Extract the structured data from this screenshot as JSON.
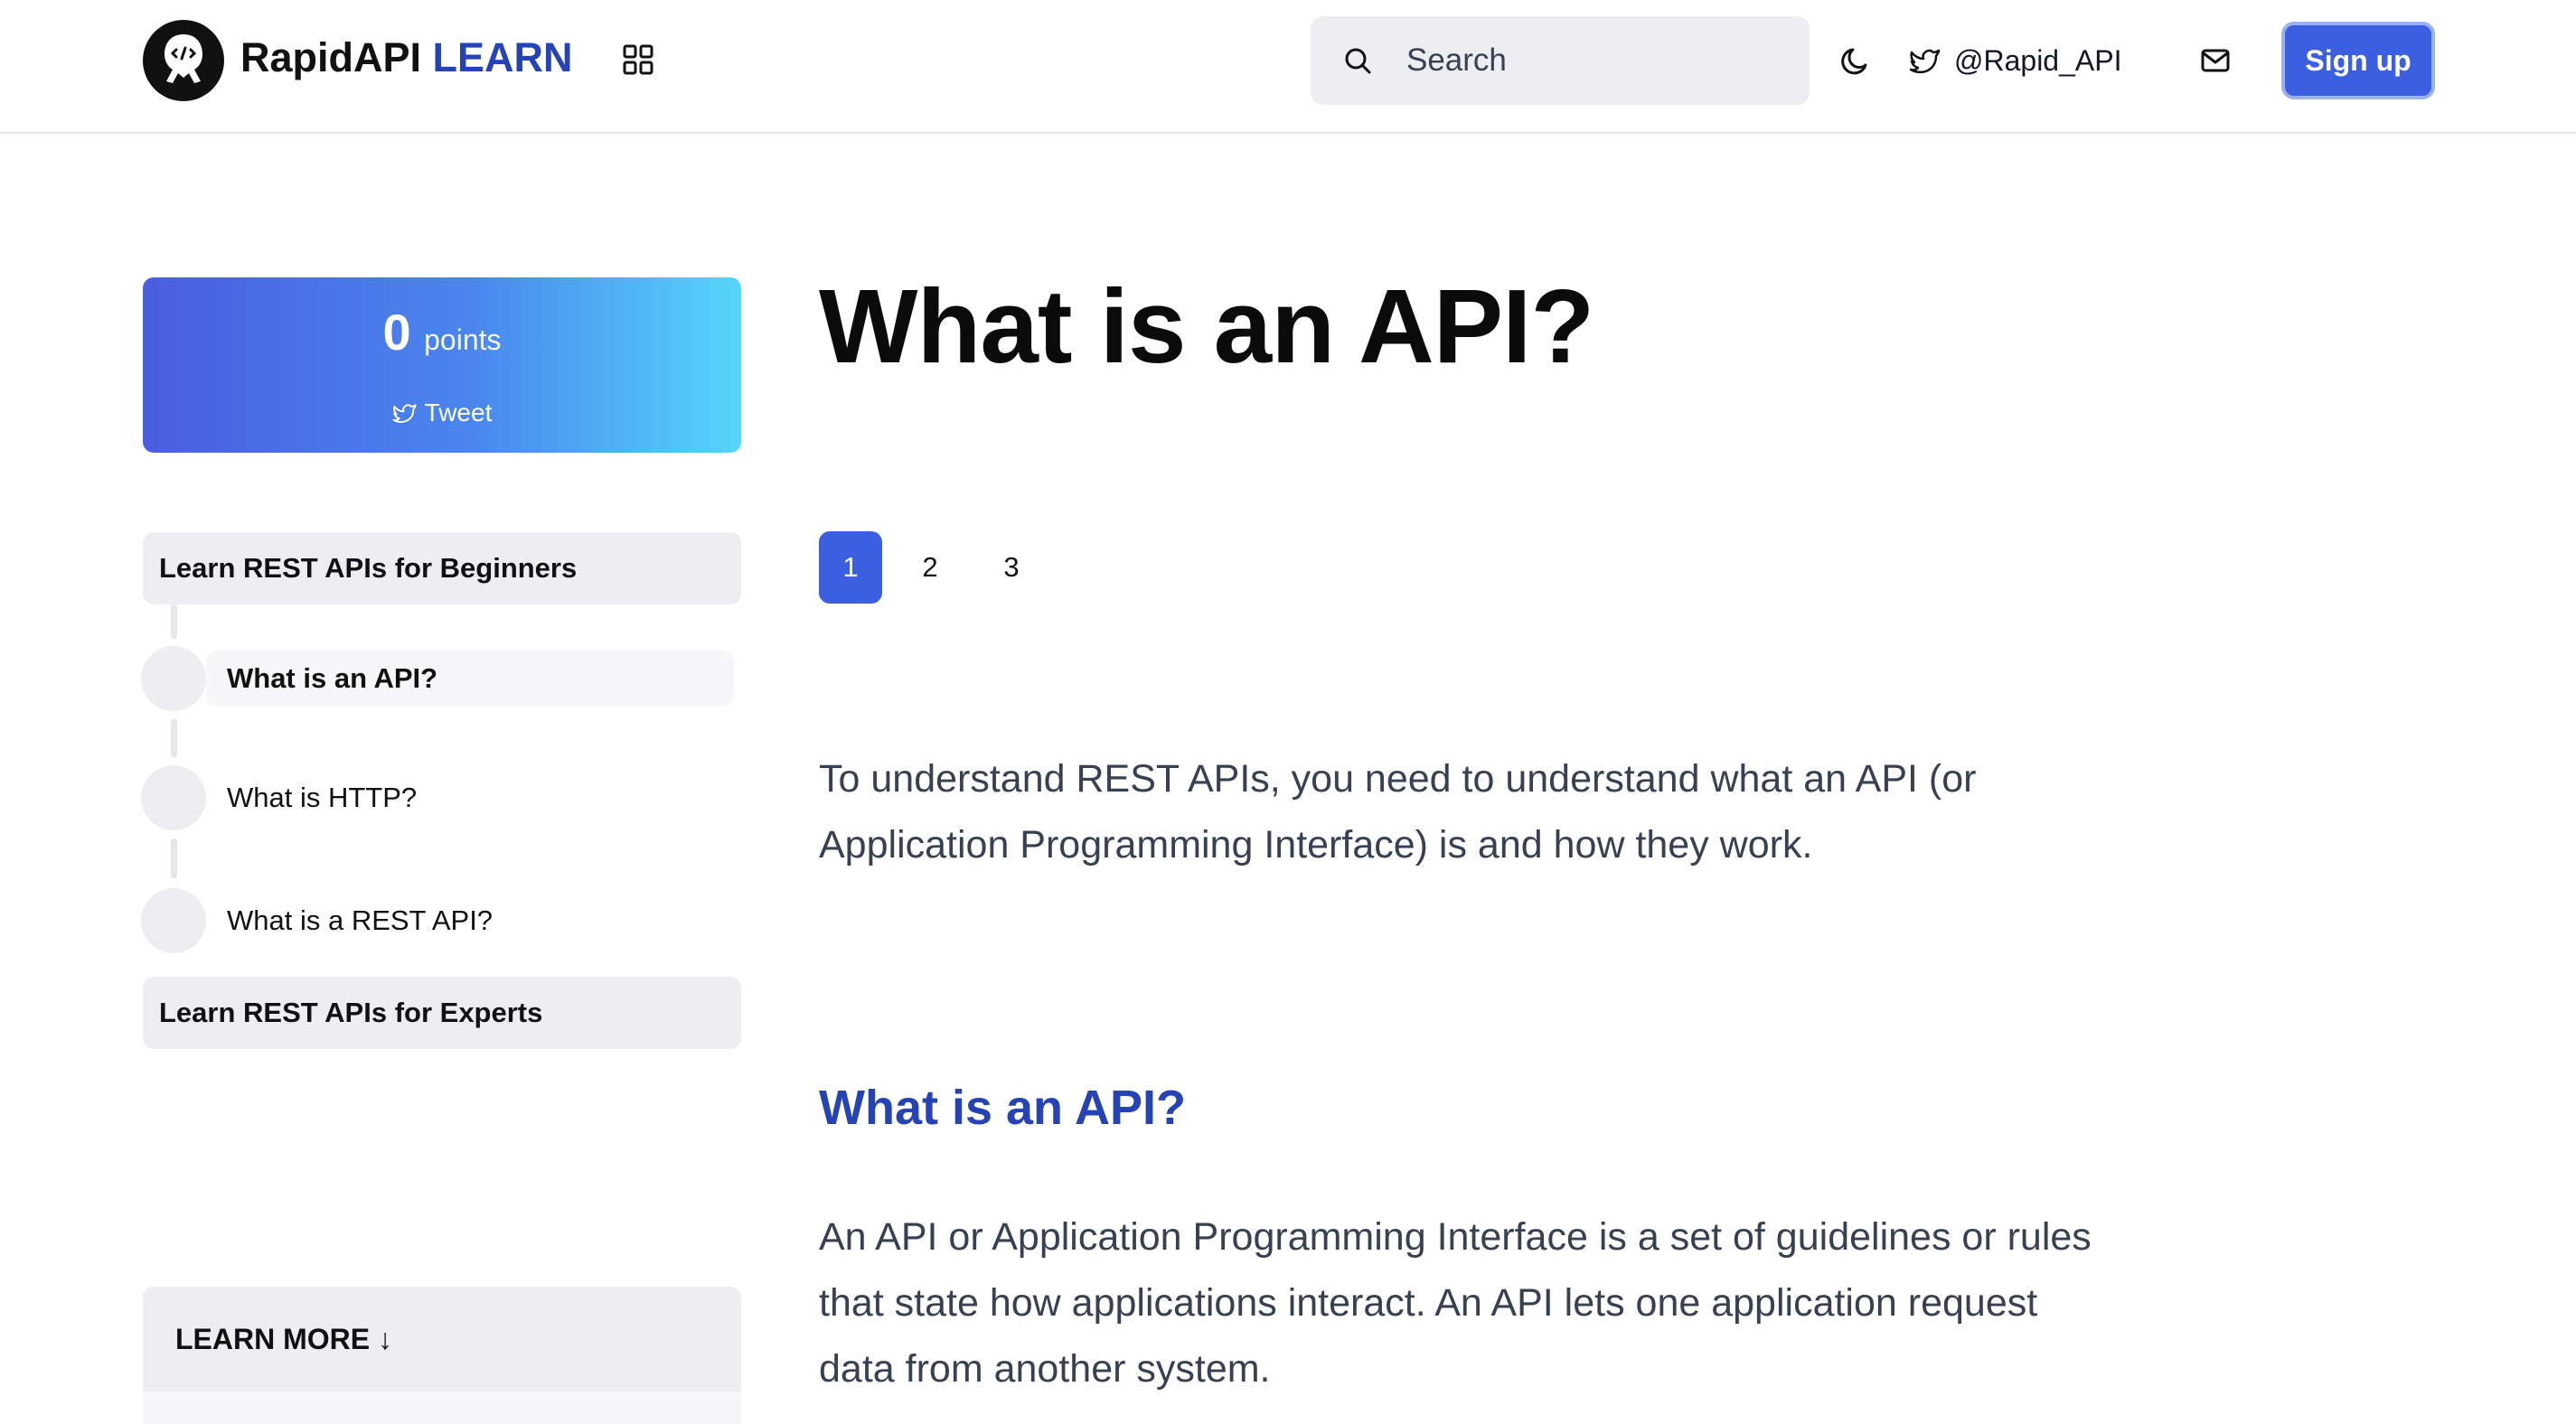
{
  "header": {
    "logo_brand": "RapidAPI",
    "logo_product": "LEARN",
    "search_placeholder": "Search",
    "twitter_handle": "@Rapid_API",
    "signup_label": "Sign up"
  },
  "sidebar": {
    "points_value": "0",
    "points_label": "points",
    "tweet_label": "Tweet",
    "courses": [
      {
        "title": "Learn REST APIs for Beginners",
        "steps": [
          {
            "label": "What is an API?",
            "active": true
          },
          {
            "label": "What is HTTP?",
            "active": false
          },
          {
            "label": "What is a REST API?",
            "active": false
          }
        ]
      },
      {
        "title": "Learn REST APIs for Experts"
      }
    ],
    "learn_more_label": "LEARN MORE ↓"
  },
  "main": {
    "title": "What is an API?",
    "pages": [
      "1",
      "2",
      "3"
    ],
    "active_page": "1",
    "intro": "To understand REST APIs, you need to understand what an API (or Application Programming Interface) is and how they work.",
    "section_heading": "What is an API?",
    "section_body": "An API or Application Programming Interface is a set of guidelines or rules that state how applications interact. An API lets one application request data from another system."
  },
  "colors": {
    "accent": "#3a5fe0",
    "brand_blue": "#2643b5",
    "gradient_start": "#4a5ee0",
    "gradient_end": "#55d6fb",
    "panel_gray": "#eceef2"
  }
}
